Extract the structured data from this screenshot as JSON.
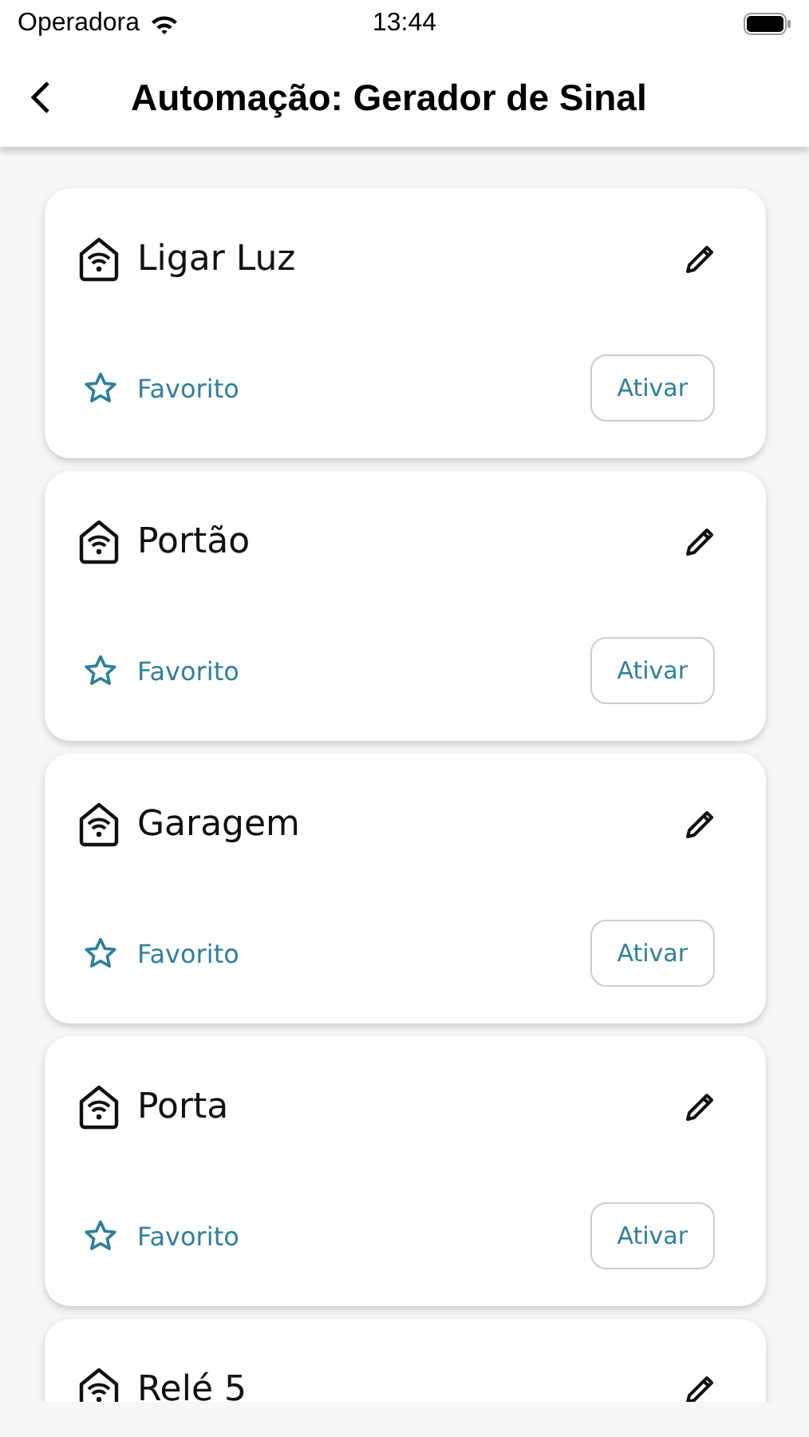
{
  "status_bar": {
    "carrier": "Operadora",
    "time": "13:44"
  },
  "header": {
    "title": "Automação: Gerador de Sinal"
  },
  "devices": [
    {
      "name": "Ligar Luz",
      "favorite_label": "Favorito",
      "favorite": false,
      "action": "Ativar"
    },
    {
      "name": "Portão",
      "favorite_label": "Favorito",
      "favorite": false,
      "action": "Ativar"
    },
    {
      "name": "Garagem",
      "favorite_label": "Favorito",
      "favorite": false,
      "action": "Ativar"
    },
    {
      "name": "Porta",
      "favorite_label": "Favorito",
      "favorite": false,
      "action": "Ativar"
    },
    {
      "name": "Relé 5"
    }
  ]
}
